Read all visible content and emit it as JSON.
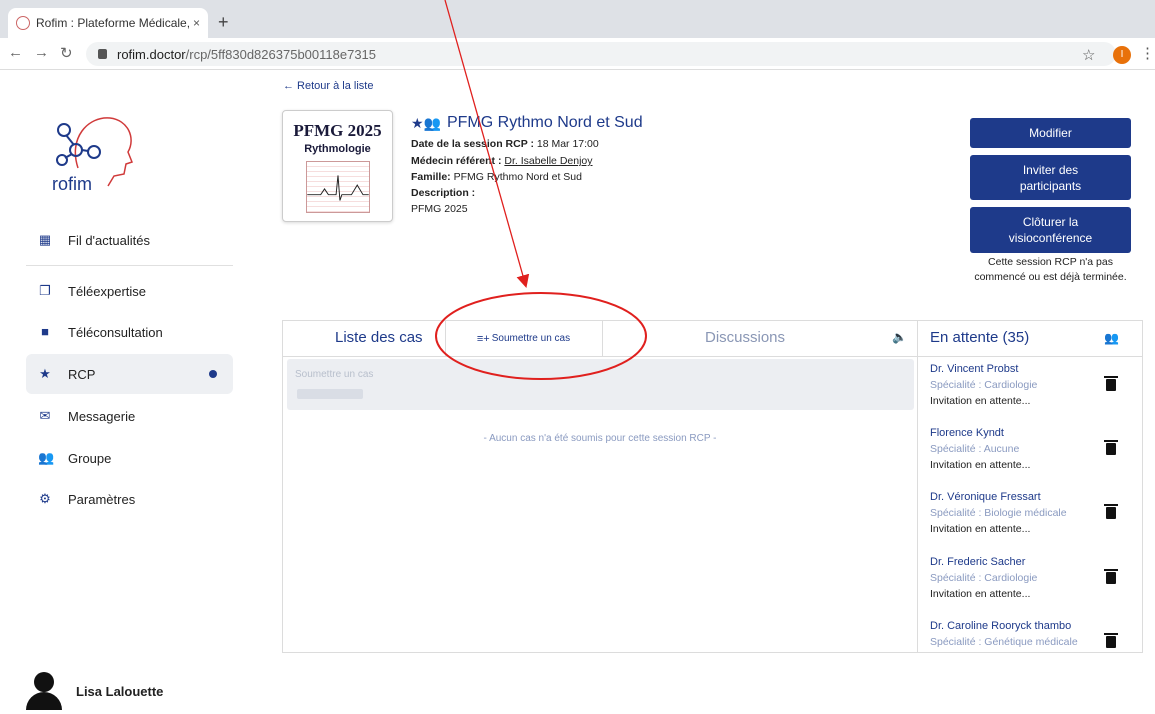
{
  "browser": {
    "tab_title": "Rofim : Plateforme Médicale, T",
    "tab_close": "×",
    "new_tab": "+",
    "url_host": "rofim.doctor",
    "url_path": "/rcp/5ff830d826375b00118e7315",
    "profile_initial": "I"
  },
  "logo": {
    "text": "rofim"
  },
  "sidebar": {
    "items": [
      {
        "label": "Fil d'actualités",
        "icon": "grid-icon"
      },
      {
        "label": "Téléexpertise",
        "icon": "copy-icon"
      },
      {
        "label": "Téléconsultation",
        "icon": "video-icon"
      },
      {
        "label": "RCP",
        "icon": "star-icon"
      },
      {
        "label": "Messagerie",
        "icon": "mail-icon"
      },
      {
        "label": "Groupe",
        "icon": "group-icon"
      },
      {
        "label": "Paramètres",
        "icon": "gear-icon"
      }
    ]
  },
  "user": {
    "name": "Lisa Lalouette"
  },
  "header": {
    "back_link": "← Retour à la liste",
    "cover_title": "PFMG 2025",
    "cover_subtitle": "Rythmologie",
    "title": "PFMG Rythmo Nord et Sud",
    "session_label": "Date de la session RCP :",
    "session_value": "18 Mar 17:00",
    "referent_label": "Médecin référent :",
    "referent_value": "Dr. Isabelle Denjoy",
    "family_label": "Famille:",
    "family_value": "PFMG Rythmo Nord et Sud",
    "description_label": "Description :",
    "description_value": "PFMG 2025"
  },
  "actions": {
    "modify": "Modifier",
    "invite": "Inviter des participants",
    "close_video": "Clôturer la visioconférence",
    "note": "Cette session RCP n'a pas commencé ou est déjà terminée."
  },
  "panel": {
    "tab_cases": "Liste des cas",
    "submit_button": "Soumettre un cas",
    "tab_discussions": "Discussions",
    "submit_placeholder": "Soumettre un cas",
    "empty_text": "- Aucun cas n'a été soumis pour cette session RCP -"
  },
  "waiting": {
    "title": "En attente (35)",
    "items": [
      {
        "name": "Dr. Vincent Probst",
        "spec": "Spécialité : Cardiologie",
        "status": "Invitation en attente..."
      },
      {
        "name": "Florence Kyndt",
        "spec": "Spécialité : Aucune",
        "status": "Invitation en attente..."
      },
      {
        "name": "Dr. Véronique Fressart",
        "spec": "Spécialité : Biologie médicale",
        "status": "Invitation en attente..."
      },
      {
        "name": "Dr. Frederic Sacher",
        "spec": "Spécialité : Cardiologie",
        "status": "Invitation en attente..."
      },
      {
        "name": "Dr. Caroline Rooryck thambo",
        "spec": "Spécialité : Génétique médicale",
        "status": ""
      }
    ]
  },
  "colors": {
    "primary": "#1e3a8a",
    "annotation": "#e0201e"
  }
}
